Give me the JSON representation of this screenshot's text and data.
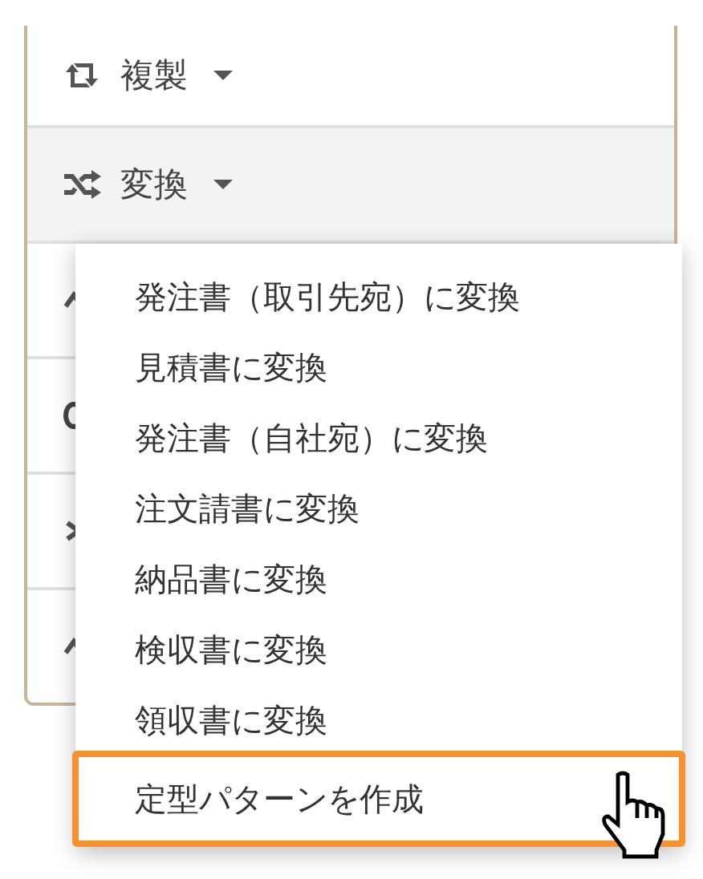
{
  "panel": {
    "rows": [
      {
        "kind": "dropdown",
        "label": "複製",
        "expanded": false
      },
      {
        "kind": "dropdown",
        "label": "変換",
        "expanded": true
      },
      {
        "kind": "covered"
      },
      {
        "kind": "covered"
      },
      {
        "kind": "covered"
      },
      {
        "kind": "covered"
      }
    ]
  },
  "menu": {
    "items": [
      {
        "label": "発注書（取引先宛）に変換",
        "selected": false
      },
      {
        "label": "見積書に変換",
        "selected": false
      },
      {
        "label": "発注書（自社宛）に変換",
        "selected": false
      },
      {
        "label": "注文請書に変換",
        "selected": false
      },
      {
        "label": "納品書に変換",
        "selected": false
      },
      {
        "label": "検収書に変換",
        "selected": false
      },
      {
        "label": "領収書に変換",
        "selected": false
      },
      {
        "label": "定型パターンを作成",
        "selected": true
      }
    ]
  }
}
